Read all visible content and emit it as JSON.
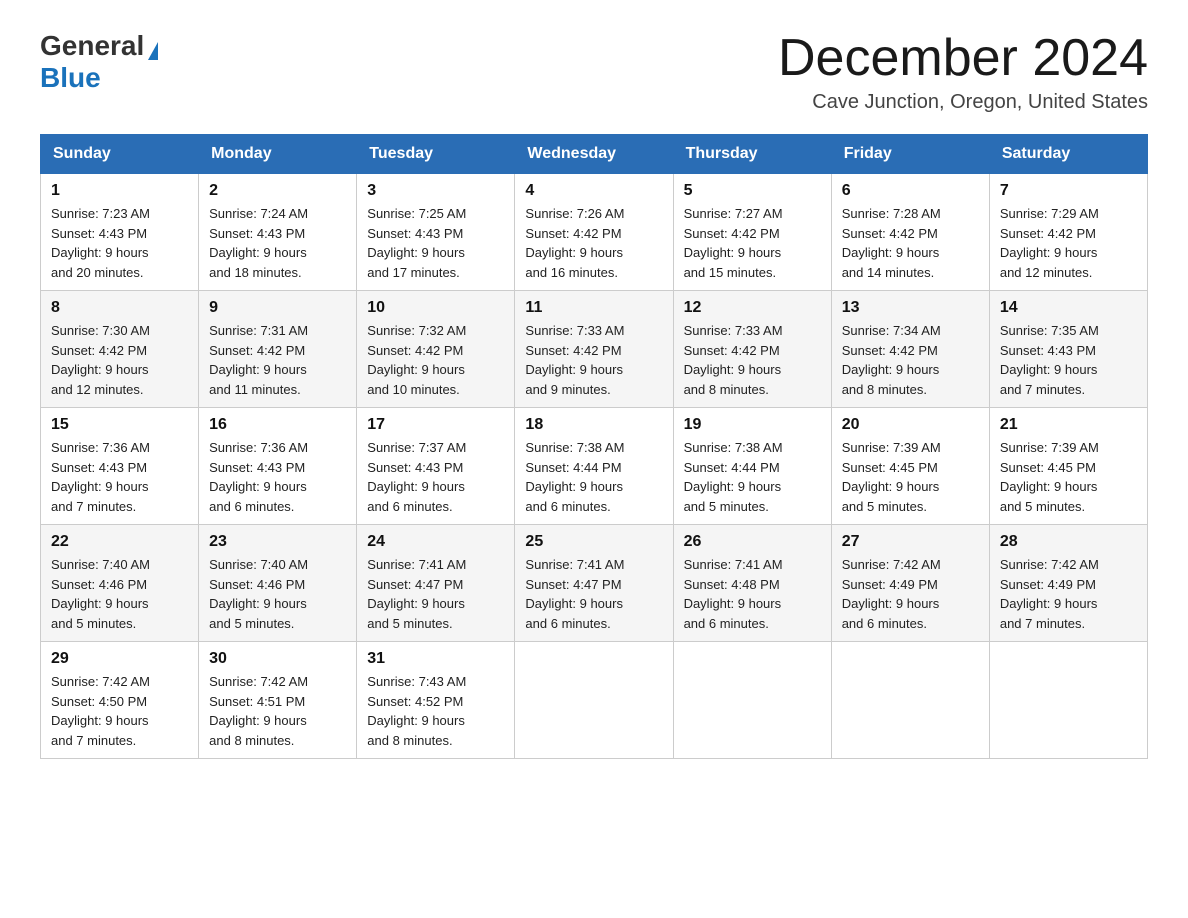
{
  "header": {
    "logo_general": "General",
    "logo_blue": "Blue",
    "month_title": "December 2024",
    "location": "Cave Junction, Oregon, United States"
  },
  "days_of_week": [
    "Sunday",
    "Monday",
    "Tuesday",
    "Wednesday",
    "Thursday",
    "Friday",
    "Saturday"
  ],
  "weeks": [
    [
      {
        "day": "1",
        "sunrise": "7:23 AM",
        "sunset": "4:43 PM",
        "daylight": "9 hours and 20 minutes."
      },
      {
        "day": "2",
        "sunrise": "7:24 AM",
        "sunset": "4:43 PM",
        "daylight": "9 hours and 18 minutes."
      },
      {
        "day": "3",
        "sunrise": "7:25 AM",
        "sunset": "4:43 PM",
        "daylight": "9 hours and 17 minutes."
      },
      {
        "day": "4",
        "sunrise": "7:26 AM",
        "sunset": "4:42 PM",
        "daylight": "9 hours and 16 minutes."
      },
      {
        "day": "5",
        "sunrise": "7:27 AM",
        "sunset": "4:42 PM",
        "daylight": "9 hours and 15 minutes."
      },
      {
        "day": "6",
        "sunrise": "7:28 AM",
        "sunset": "4:42 PM",
        "daylight": "9 hours and 14 minutes."
      },
      {
        "day": "7",
        "sunrise": "7:29 AM",
        "sunset": "4:42 PM",
        "daylight": "9 hours and 12 minutes."
      }
    ],
    [
      {
        "day": "8",
        "sunrise": "7:30 AM",
        "sunset": "4:42 PM",
        "daylight": "9 hours and 12 minutes."
      },
      {
        "day": "9",
        "sunrise": "7:31 AM",
        "sunset": "4:42 PM",
        "daylight": "9 hours and 11 minutes."
      },
      {
        "day": "10",
        "sunrise": "7:32 AM",
        "sunset": "4:42 PM",
        "daylight": "9 hours and 10 minutes."
      },
      {
        "day": "11",
        "sunrise": "7:33 AM",
        "sunset": "4:42 PM",
        "daylight": "9 hours and 9 minutes."
      },
      {
        "day": "12",
        "sunrise": "7:33 AM",
        "sunset": "4:42 PM",
        "daylight": "9 hours and 8 minutes."
      },
      {
        "day": "13",
        "sunrise": "7:34 AM",
        "sunset": "4:42 PM",
        "daylight": "9 hours and 8 minutes."
      },
      {
        "day": "14",
        "sunrise": "7:35 AM",
        "sunset": "4:43 PM",
        "daylight": "9 hours and 7 minutes."
      }
    ],
    [
      {
        "day": "15",
        "sunrise": "7:36 AM",
        "sunset": "4:43 PM",
        "daylight": "9 hours and 7 minutes."
      },
      {
        "day": "16",
        "sunrise": "7:36 AM",
        "sunset": "4:43 PM",
        "daylight": "9 hours and 6 minutes."
      },
      {
        "day": "17",
        "sunrise": "7:37 AM",
        "sunset": "4:43 PM",
        "daylight": "9 hours and 6 minutes."
      },
      {
        "day": "18",
        "sunrise": "7:38 AM",
        "sunset": "4:44 PM",
        "daylight": "9 hours and 6 minutes."
      },
      {
        "day": "19",
        "sunrise": "7:38 AM",
        "sunset": "4:44 PM",
        "daylight": "9 hours and 5 minutes."
      },
      {
        "day": "20",
        "sunrise": "7:39 AM",
        "sunset": "4:45 PM",
        "daylight": "9 hours and 5 minutes."
      },
      {
        "day": "21",
        "sunrise": "7:39 AM",
        "sunset": "4:45 PM",
        "daylight": "9 hours and 5 minutes."
      }
    ],
    [
      {
        "day": "22",
        "sunrise": "7:40 AM",
        "sunset": "4:46 PM",
        "daylight": "9 hours and 5 minutes."
      },
      {
        "day": "23",
        "sunrise": "7:40 AM",
        "sunset": "4:46 PM",
        "daylight": "9 hours and 5 minutes."
      },
      {
        "day": "24",
        "sunrise": "7:41 AM",
        "sunset": "4:47 PM",
        "daylight": "9 hours and 5 minutes."
      },
      {
        "day": "25",
        "sunrise": "7:41 AM",
        "sunset": "4:47 PM",
        "daylight": "9 hours and 6 minutes."
      },
      {
        "day": "26",
        "sunrise": "7:41 AM",
        "sunset": "4:48 PM",
        "daylight": "9 hours and 6 minutes."
      },
      {
        "day": "27",
        "sunrise": "7:42 AM",
        "sunset": "4:49 PM",
        "daylight": "9 hours and 6 minutes."
      },
      {
        "day": "28",
        "sunrise": "7:42 AM",
        "sunset": "4:49 PM",
        "daylight": "9 hours and 7 minutes."
      }
    ],
    [
      {
        "day": "29",
        "sunrise": "7:42 AM",
        "sunset": "4:50 PM",
        "daylight": "9 hours and 7 minutes."
      },
      {
        "day": "30",
        "sunrise": "7:42 AM",
        "sunset": "4:51 PM",
        "daylight": "9 hours and 8 minutes."
      },
      {
        "day": "31",
        "sunrise": "7:43 AM",
        "sunset": "4:52 PM",
        "daylight": "9 hours and 8 minutes."
      },
      null,
      null,
      null,
      null
    ]
  ],
  "labels": {
    "sunrise": "Sunrise:",
    "sunset": "Sunset:",
    "daylight": "Daylight:"
  }
}
